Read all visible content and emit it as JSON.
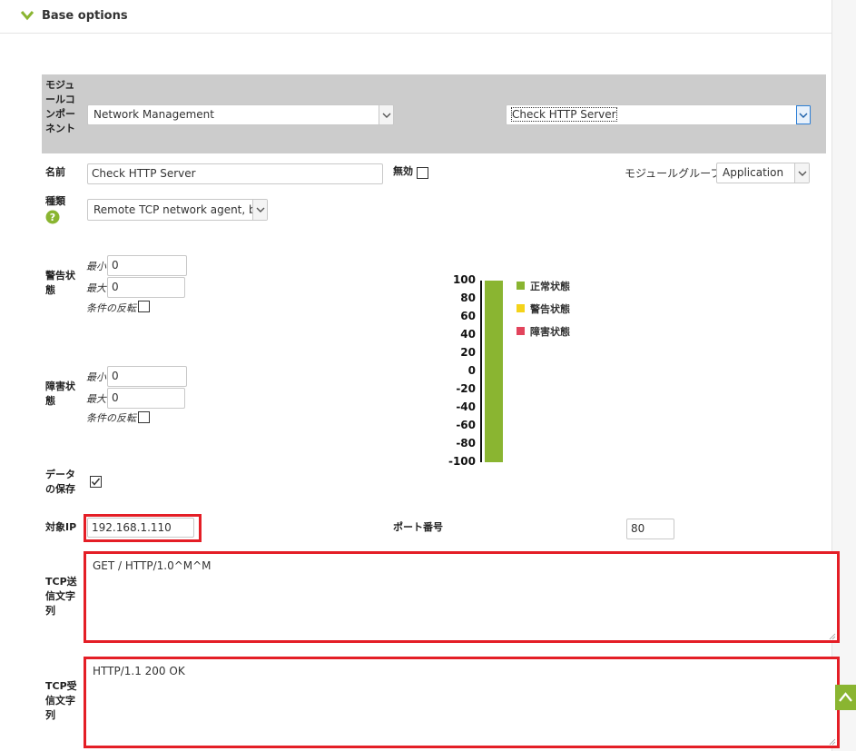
{
  "section": {
    "title": "Base options"
  },
  "module_component": {
    "label": "モジュールコンポーネント",
    "group_select": "Network Management",
    "component_select": "Check HTTP Server"
  },
  "name": {
    "label": "名前",
    "value": "Check HTTP Server"
  },
  "disabled": {
    "label": "無効",
    "checked": false
  },
  "module_group": {
    "label": "モジュールグループ",
    "value": "Application"
  },
  "type": {
    "label": "種類",
    "value": "Remote TCP network agent, bo"
  },
  "warning": {
    "label": "警告状態",
    "min_label": "最小",
    "min_value": "0",
    "max_label": "最大",
    "max_value": "0",
    "invert_label": "条件の反転"
  },
  "critical": {
    "label": "障害状態",
    "min_label": "最小",
    "min_value": "0",
    "max_label": "最大",
    "max_value": "0",
    "invert_label": "条件の反転"
  },
  "chart_data": {
    "type": "bar",
    "ylim": [
      -100,
      100
    ],
    "yticks": [
      "100",
      "80",
      "60",
      "40",
      "20",
      "0",
      "-20",
      "-40",
      "-60",
      "-80",
      "-100"
    ],
    "normal_range": [
      -100,
      100
    ],
    "legend": [
      {
        "name": "正常状態",
        "color": "#8ab531"
      },
      {
        "name": "警告状態",
        "color": "#f4d31a"
      },
      {
        "name": "障害状態",
        "color": "#e2445c"
      }
    ]
  },
  "data_save": {
    "label": "データの保存",
    "checked": true
  },
  "target_ip": {
    "label": "対象IP",
    "value": "192.168.1.110"
  },
  "port": {
    "label": "ポート番号",
    "value": "80"
  },
  "tcp_send": {
    "label": "TCP送信文字列",
    "value": "GET / HTTP/1.0^M^M"
  },
  "tcp_recv": {
    "label": "TCP受信文字列",
    "value": "HTTP/1.1 200 OK"
  },
  "colors": {
    "accent_green": "#8ab531",
    "highlight_red": "#e41e26"
  },
  "icons": {
    "collapse": "chevron-down-icon",
    "help": "help-icon",
    "scroll_top": "chevron-up-icon"
  }
}
